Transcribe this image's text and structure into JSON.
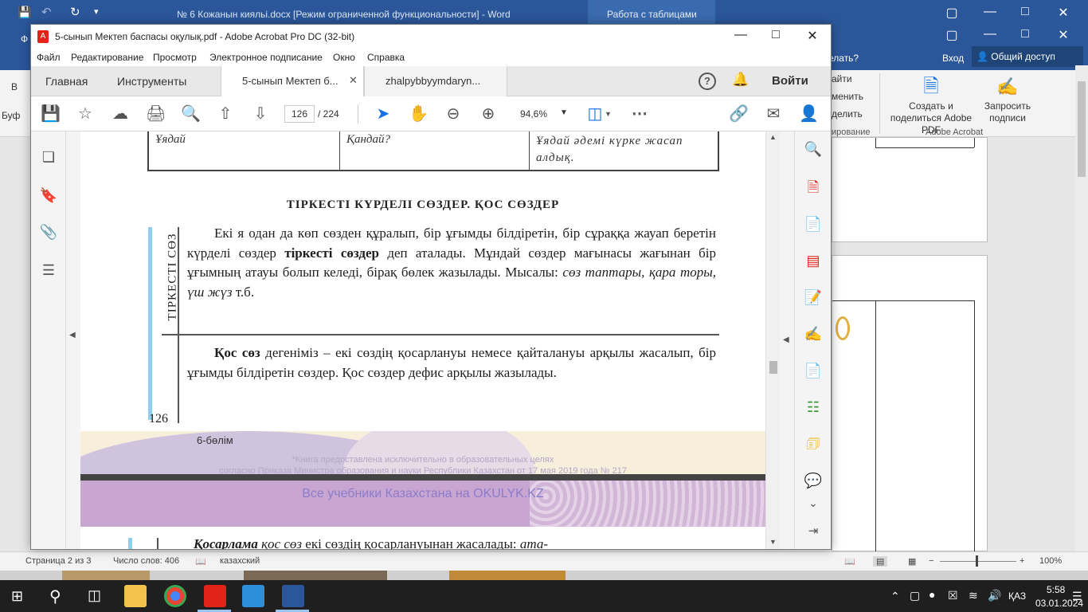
{
  "word": {
    "title": "№ 6 Кожанын кияльі.docx [Режим ограниченной функциональности] - Word",
    "context_tab": "Работа с таблицами",
    "tell_me": "елать?",
    "login": "Вход",
    "share": "Общий доступ",
    "ribbon": {
      "partial_items": [
        "айти",
        "менить",
        "делить",
        "ирование"
      ],
      "create_share_pdf": "Создать и поделиться Adobe PDF",
      "request_signatures": "Запросить подписи",
      "group_label": "Adobe Acrobat",
      "left_clip": [
        "Ф",
        "В",
        "Буф"
      ]
    },
    "status": {
      "page": "Страница 2 из 3",
      "words": "Число слов: 406",
      "language": "казахский",
      "zoom": "100%"
    }
  },
  "acrobat": {
    "title": "5-сынып Мектеп баспасы оқулық.pdf - Adobe Acrobat Pro DC (32-bit)",
    "menu": [
      "Файл",
      "Редактирование",
      "Просмотр",
      "Электронное подписание",
      "Окно",
      "Справка"
    ],
    "tabs": {
      "home": "Главная",
      "tools": "Инструменты",
      "doc1": "5-сынып Мектеп б...",
      "doc2": "zhalpybbyymdaryn...",
      "login": "Войти"
    },
    "toolbar": {
      "current_page": "126",
      "total_pages": "/  224",
      "zoom": "94,6%"
    }
  },
  "page": {
    "table": {
      "col1": "Ұядай",
      "col2": "Қандай?",
      "col3": "Ұядай әдемі күрке жасап алдық."
    },
    "heading": "ТІРКЕСТІ КҮРДЕЛІ СӨЗДЕР. ҚОС СӨЗДЕР",
    "side_label": "ТІРКЕСТІ СӨЗ",
    "para1": {
      "a": "Екі я одан да көп сөзден құралып, бір ұғымды білдіретін, бір сұраққа жауап беретін күрделі сөздер ",
      "b": "тіркесті сөздер",
      "c": " деп аталады. Мұндай сөздер мағынасы жағынан бір ұғымның атауы болып келеді, бірақ бөлек жазылады. Мысалы: ",
      "d": "сөз таптары, қара торы, үш жүз",
      "e": " т.б."
    },
    "para2": {
      "a": "Қос сөз",
      "b": " дегеніміз – екі сөздің қосарлануы немесе қайталануы арқылы жасалып, бір ұғымды білдіретін сөздер. Қос сөздер дефис арқылы жазылады."
    },
    "page_number": "126",
    "section": "6-бөлім",
    "watermark1": "*Книга предоставлена исключительно в образовательных целях",
    "watermark2": "согласно Приказа Министра образования и науки Республики Казахстан от 17 мая 2019 года № 217",
    "ad": "Все учебники Казахстана на OKULYK.KZ",
    "next_line": {
      "a": "Қосарлама",
      "b": " қос сөз",
      "c": " екі сөздің қосарлануынан жасалады: ",
      "d": "ата-"
    }
  },
  "taskbar": {
    "lang": "ҚАЗ",
    "time": "5:58",
    "date": "03.01.2024"
  },
  "colors": {
    "word_blue": "#2b579a",
    "acrobat_red": "#e2231a",
    "accent_blue": "#1473e6"
  }
}
